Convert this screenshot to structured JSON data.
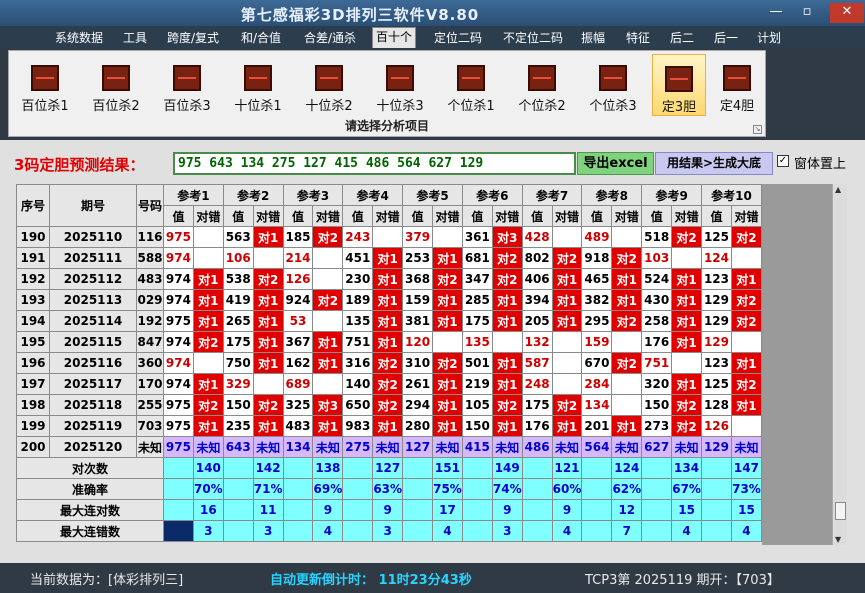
{
  "window": {
    "title": "第七感福彩3D排列三软件V8.80",
    "min": "—",
    "max": "▫",
    "close": "✕"
  },
  "menu": [
    "系统数据",
    "工具",
    "跨度/复式",
    "和/合值",
    "合差/通杀",
    "百十个",
    "定位二码",
    "不定位二码",
    "振幅",
    "特征",
    "后二",
    "后一",
    "计划"
  ],
  "menu_active": "百十个",
  "ribbon": {
    "buttons": [
      "百位杀1",
      "百位杀2",
      "百位杀3",
      "十位杀1",
      "十位杀2",
      "十位杀3",
      "个位杀1",
      "个位杀2",
      "个位杀3",
      "定3胆",
      "定4胆"
    ],
    "selected": "定3胆",
    "caption": "请选择分析项目"
  },
  "result": {
    "label": "3码定胆预测结果：",
    "value": "975 643 134 275 127 415 486 564 627 129"
  },
  "buttons": {
    "excel": "导出excel",
    "generate": "用结果>生成大底"
  },
  "checkbox": {
    "label": "窗体置上",
    "checked": "✓"
  },
  "table": {
    "h_index": "序号",
    "h_period": "期号",
    "h_number": "号码",
    "refs": [
      "参考1",
      "参考2",
      "参考3",
      "参考4",
      "参考5",
      "参考6",
      "参考7",
      "参考8",
      "参考9",
      "参考10"
    ],
    "h_val": "值",
    "h_res": "对错",
    "rows": [
      {
        "i": "190",
        "p": "2025110",
        "n": "116",
        "c": [
          [
            "975",
            ""
          ],
          [
            "563",
            "对1"
          ],
          [
            "185",
            "对2"
          ],
          [
            "243",
            ""
          ],
          [
            "379",
            ""
          ],
          [
            "361",
            "对3"
          ],
          [
            "428",
            ""
          ],
          [
            "489",
            ""
          ],
          [
            "518",
            "对2"
          ],
          [
            "125",
            "对2"
          ]
        ]
      },
      {
        "i": "191",
        "p": "2025111",
        "n": "588",
        "c": [
          [
            "974",
            ""
          ],
          [
            "106",
            ""
          ],
          [
            "214",
            ""
          ],
          [
            "451",
            "对1"
          ],
          [
            "253",
            "对1"
          ],
          [
            "681",
            "对2"
          ],
          [
            "802",
            "对2"
          ],
          [
            "918",
            "对2"
          ],
          [
            "103",
            ""
          ],
          [
            "124",
            ""
          ]
        ]
      },
      {
        "i": "192",
        "p": "2025112",
        "n": "483",
        "c": [
          [
            "974",
            "对1"
          ],
          [
            "538",
            "对2"
          ],
          [
            "126",
            ""
          ],
          [
            "230",
            "对1"
          ],
          [
            "368",
            "对2"
          ],
          [
            "347",
            "对2"
          ],
          [
            "406",
            "对1"
          ],
          [
            "465",
            "对1"
          ],
          [
            "524",
            "对1"
          ],
          [
            "123",
            "对1"
          ]
        ]
      },
      {
        "i": "193",
        "p": "2025113",
        "n": "029",
        "c": [
          [
            "974",
            "对1"
          ],
          [
            "419",
            "对1"
          ],
          [
            "924",
            "对2"
          ],
          [
            "189",
            "对1"
          ],
          [
            "159",
            "对1"
          ],
          [
            "285",
            "对1"
          ],
          [
            "394",
            "对1"
          ],
          [
            "382",
            "对1"
          ],
          [
            "430",
            "对1"
          ],
          [
            "129",
            "对2"
          ]
        ]
      },
      {
        "i": "194",
        "p": "2025114",
        "n": "192",
        "c": [
          [
            "975",
            "对1"
          ],
          [
            "265",
            "对1"
          ],
          [
            "53",
            ""
          ],
          [
            "135",
            "对1"
          ],
          [
            "381",
            "对1"
          ],
          [
            "175",
            "对1"
          ],
          [
            "205",
            "对1"
          ],
          [
            "295",
            "对2"
          ],
          [
            "258",
            "对1"
          ],
          [
            "129",
            "对2"
          ]
        ]
      },
      {
        "i": "195",
        "p": "2025115",
        "n": "847",
        "c": [
          [
            "974",
            "对2"
          ],
          [
            "175",
            "对1"
          ],
          [
            "367",
            "对1"
          ],
          [
            "751",
            "对1"
          ],
          [
            "120",
            ""
          ],
          [
            "135",
            ""
          ],
          [
            "132",
            ""
          ],
          [
            "159",
            ""
          ],
          [
            "176",
            "对1"
          ],
          [
            "129",
            ""
          ]
        ]
      },
      {
        "i": "196",
        "p": "2025116",
        "n": "360",
        "c": [
          [
            "974",
            ""
          ],
          [
            "750",
            "对1"
          ],
          [
            "162",
            "对1"
          ],
          [
            "316",
            "对2"
          ],
          [
            "310",
            "对2"
          ],
          [
            "501",
            "对1"
          ],
          [
            "587",
            ""
          ],
          [
            "670",
            "对2"
          ],
          [
            "751",
            ""
          ],
          [
            "123",
            "对1"
          ]
        ]
      },
      {
        "i": "197",
        "p": "2025117",
        "n": "170",
        "c": [
          [
            "974",
            "对1"
          ],
          [
            "329",
            ""
          ],
          [
            "689",
            ""
          ],
          [
            "140",
            "对2"
          ],
          [
            "261",
            "对1"
          ],
          [
            "219",
            "对1"
          ],
          [
            "248",
            ""
          ],
          [
            "284",
            ""
          ],
          [
            "320",
            "对1"
          ],
          [
            "125",
            "对2"
          ]
        ]
      },
      {
        "i": "198",
        "p": "2025118",
        "n": "255",
        "c": [
          [
            "975",
            "对2"
          ],
          [
            "150",
            "对2"
          ],
          [
            "325",
            "对3"
          ],
          [
            "650",
            "对2"
          ],
          [
            "294",
            "对1"
          ],
          [
            "105",
            "对2"
          ],
          [
            "175",
            "对2"
          ],
          [
            "134",
            ""
          ],
          [
            "150",
            "对2"
          ],
          [
            "128",
            "对1"
          ]
        ]
      },
      {
        "i": "199",
        "p": "2025119",
        "n": "703",
        "c": [
          [
            "975",
            "对1"
          ],
          [
            "235",
            "对1"
          ],
          [
            "483",
            "对1"
          ],
          [
            "983",
            "对1"
          ],
          [
            "280",
            "对1"
          ],
          [
            "150",
            "对1"
          ],
          [
            "176",
            "对1"
          ],
          [
            "201",
            "对1"
          ],
          [
            "273",
            "对2"
          ],
          [
            "126",
            ""
          ]
        ]
      }
    ],
    "pending": {
      "i": "200",
      "p": "2025120",
      "n": "未知",
      "c": [
        "975",
        "643",
        "134",
        "275",
        "127",
        "415",
        "486",
        "564",
        "627",
        "129"
      ],
      "unknown": "未知"
    },
    "stats": [
      {
        "label": "对次数",
        "values": [
          "140",
          "142",
          "138",
          "127",
          "151",
          "149",
          "121",
          "124",
          "134",
          "147"
        ]
      },
      {
        "label": "准确率",
        "values": [
          "70%",
          "71%",
          "69%",
          "63%",
          "75%",
          "74%",
          "60%",
          "62%",
          "67%",
          "73%"
        ]
      },
      {
        "label": "最大连对数",
        "values": [
          "16",
          "11",
          "9",
          "9",
          "17",
          "9",
          "9",
          "12",
          "15",
          "15"
        ]
      },
      {
        "label": "最大连错数",
        "values": [
          "3",
          "3",
          "4",
          "3",
          "4",
          "3",
          "4",
          "7",
          "4",
          "4"
        ]
      }
    ]
  },
  "status": {
    "current": "当前数据为：[体彩排列三]",
    "countdown": "自动更新倒计时： 11时23分43秒",
    "period": "TCP3第 2025119 期开：【703】"
  },
  "colors": {
    "hit": "#e00000",
    "miss_value": "#cc0000",
    "pending": "#d6b8ff",
    "stats": "#7fffff",
    "title": "#e8f0ff"
  }
}
